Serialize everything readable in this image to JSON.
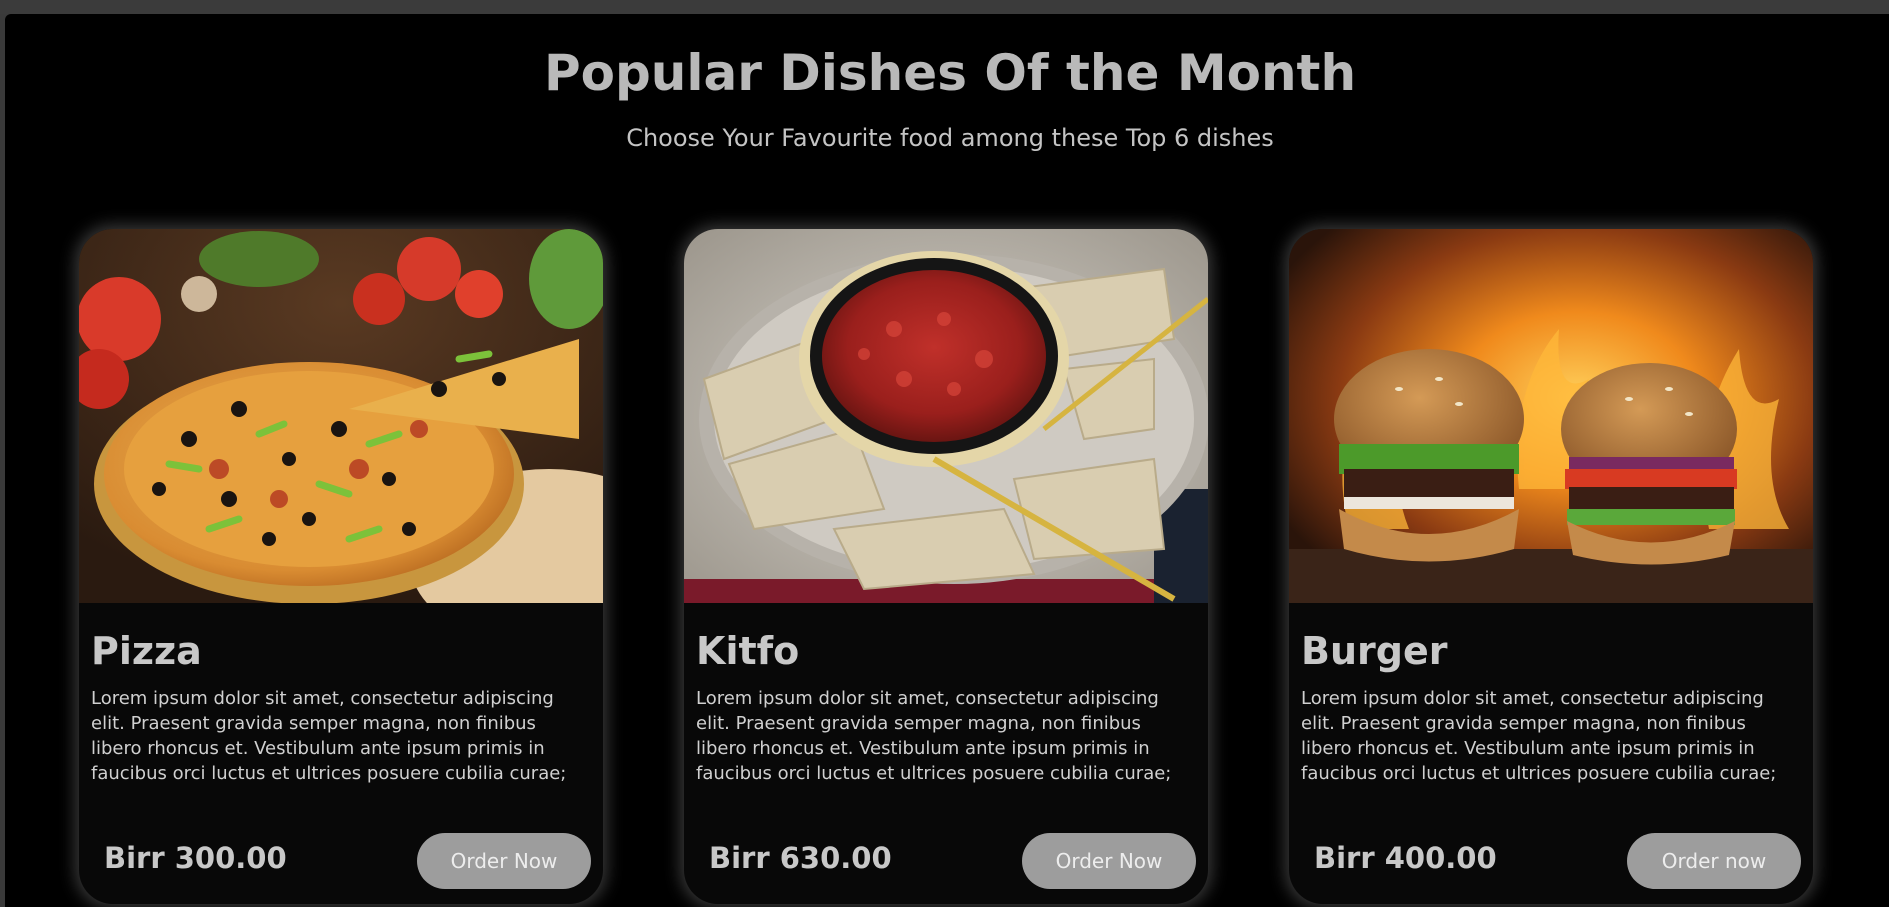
{
  "section": {
    "title": "Popular Dishes Of the Month",
    "subtitle": "Choose Your Favourite food among these Top 6 dishes"
  },
  "dishes": [
    {
      "name": "Pizza",
      "description": "Lorem ipsum dolor sit amet, consectetur adipiscing elit. Praesent gravida semper magna, non finibus libero rhoncus et. Vestibulum ante ipsum primis in faucibus orci luctus et ultrices posuere cubilia curae;",
      "price": "Birr 300.00",
      "button_label": "Order Now",
      "image_icon": "pizza-photo"
    },
    {
      "name": "Kitfo",
      "description": "Lorem ipsum dolor sit amet, consectetur adipiscing elit. Praesent gravida semper magna, non finibus libero rhoncus et. Vestibulum ante ipsum primis in faucibus orci luctus et ultrices posuere cubilia curae;",
      "price": "Birr 630.00",
      "button_label": "Order Now",
      "image_icon": "kitfo-photo"
    },
    {
      "name": "Burger",
      "description": "Lorem ipsum dolor sit amet, consectetur adipiscing elit. Praesent gravida semper magna, non finibus libero rhoncus et. Vestibulum ante ipsum primis in faucibus orci luctus et ultrices posuere cubilia curae;",
      "price": "Birr 400.00",
      "button_label": "Order now",
      "image_icon": "burger-photo"
    }
  ],
  "colors": {
    "background": "#000000",
    "card_background": "#080808",
    "heading_text": "#b9b9b9",
    "button_background": "#9d9d9d",
    "button_text": "#ededed"
  }
}
